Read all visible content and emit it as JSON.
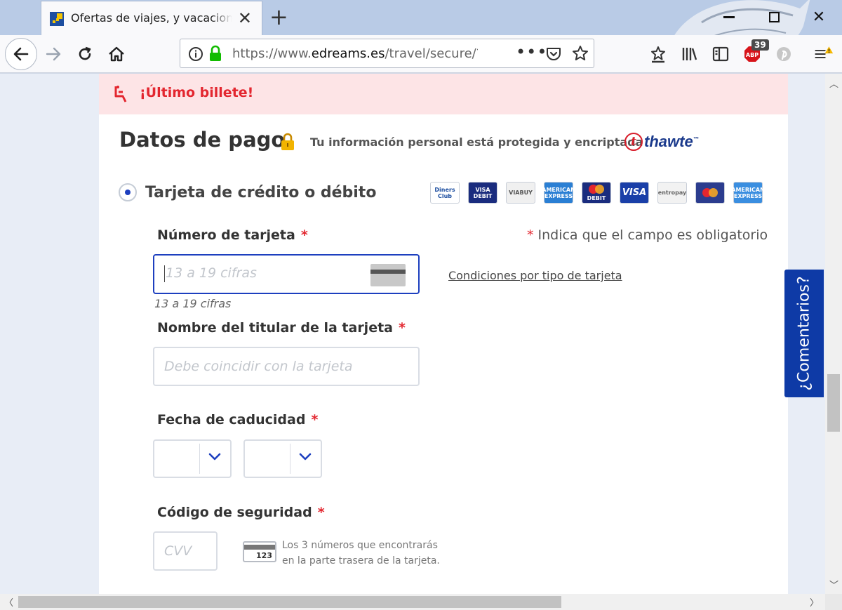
{
  "browser": {
    "tab_title": "Ofertas de viajes, y vacaciones",
    "url_prefix": "https://www.",
    "url_domain": "edreams.es",
    "url_path": "/travel/secure/?la",
    "url_more": "•••",
    "adblock_count": "39",
    "close_symbol": "✕",
    "new_tab_symbol": "+"
  },
  "alert": {
    "text": "¡Último billete!",
    "color": "#e3262f"
  },
  "payment": {
    "title": "Datos de pago",
    "protected_text": "Tu información personal está protegida y encriptada",
    "thawte_letter": "t",
    "thawte_word": "thawte",
    "thawte_tm": "™",
    "method_label": "Tarjeta de crédito o débito",
    "cards": [
      {
        "name": "diners",
        "label": "Diners Club"
      },
      {
        "name": "visa-debit",
        "label": "VISA DEBIT"
      },
      {
        "name": "viabuy",
        "label": "VIABUY"
      },
      {
        "name": "american-express",
        "label": "AMERICAN EXPRESS"
      },
      {
        "name": "mastercard-debit",
        "label": "DEBIT"
      },
      {
        "name": "visa",
        "label": "VISA"
      },
      {
        "name": "entropay",
        "label": "entropay"
      },
      {
        "name": "mastercard",
        "label": ""
      },
      {
        "name": "american-express-2",
        "label": "AMERICAN EXPRESS"
      }
    ],
    "required_mark": "*",
    "required_note": "Indica que el campo es obligatorio",
    "card_number": {
      "label": "Número de tarjeta",
      "placeholder": "13 a 19 cifras",
      "hint": "13 a 19 cifras",
      "conditions_link": "Condiciones por tipo de tarjeta"
    },
    "holder": {
      "label": "Nombre del titular de la tarjeta",
      "placeholder": "Debe coincidir con la tarjeta"
    },
    "expiry": {
      "label": "Fecha de caducidad",
      "month_value": "",
      "year_value": ""
    },
    "cvv": {
      "label": "Código de seguridad",
      "placeholder": "CVV",
      "card_number": "123",
      "help_line1": "Los 3 números que encontrarás",
      "help_line2": "en la parte trasera de la tarjeta."
    }
  },
  "feedback": {
    "label": "¿Comentarios?"
  },
  "colors": {
    "accent": "#1d3fbf",
    "feedback_bg": "#0e3aa6",
    "alert_bg": "#fde4e6"
  }
}
